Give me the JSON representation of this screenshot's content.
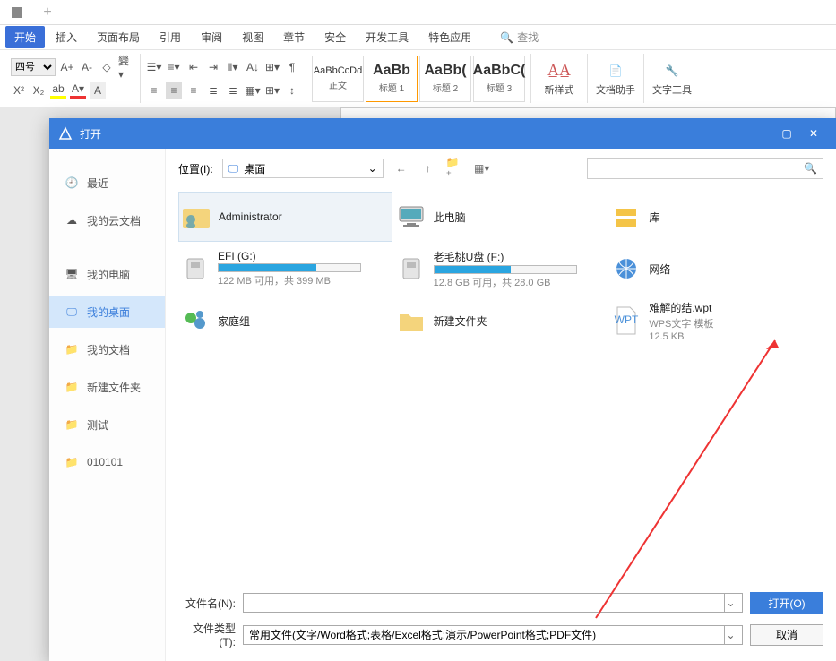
{
  "tabs": {
    "start": "开始",
    "insert": "插入",
    "layout": "页面布局",
    "ref": "引用",
    "review": "审阅",
    "view": "视图",
    "chapter": "章节",
    "security": "安全",
    "dev": "开发工具",
    "special": "特色应用",
    "search": "查找"
  },
  "ribbon": {
    "font_size": "四号",
    "styles": {
      "body": {
        "preview": "AaBbCcDd",
        "label": "正文"
      },
      "h1": {
        "preview": "AaBb",
        "label": "标题 1"
      },
      "h2": {
        "preview": "AaBb(",
        "label": "标题 2"
      },
      "h3": {
        "preview": "AaBbC(",
        "label": "标题 3"
      }
    },
    "newstyle": "新样式",
    "dochelper": "文档助手",
    "texttools": "文字工具"
  },
  "dialog": {
    "title": "打开",
    "sidebar": {
      "recent": "最近",
      "cloud": "我的云文档",
      "computer": "我的电脑",
      "desktop": "我的桌面",
      "docs": "我的文档",
      "newfolder": "新建文件夹",
      "test": "测试",
      "num": "010101"
    },
    "location_label": "位置(I):",
    "location_value": "桌面",
    "items": {
      "admin": {
        "name": "Administrator"
      },
      "pc": {
        "name": "此电脑"
      },
      "lib": {
        "name": "库"
      },
      "efi": {
        "name": "EFI (G:)",
        "sub": "122 MB 可用，共 399 MB",
        "pct": 69
      },
      "udisk": {
        "name": "老毛桃U盘 (F:)",
        "sub": "12.8 GB 可用，共 28.0 GB",
        "pct": 54
      },
      "net": {
        "name": "网络"
      },
      "homegroup": {
        "name": "家庭组"
      },
      "folder": {
        "name": "新建文件夹"
      },
      "wpt": {
        "name": "难解的结.wpt",
        "sub1": "WPS文字 模板",
        "sub2": "12.5 KB"
      }
    },
    "filename_label": "文件名(N):",
    "filename_value": "",
    "filetype_label": "文件类型(T):",
    "filetype_value": "常用文件(文字/Word格式;表格/Excel格式;演示/PowerPoint格式;PDF文件)",
    "open_btn": "打开(O)",
    "cancel_btn": "取消"
  }
}
